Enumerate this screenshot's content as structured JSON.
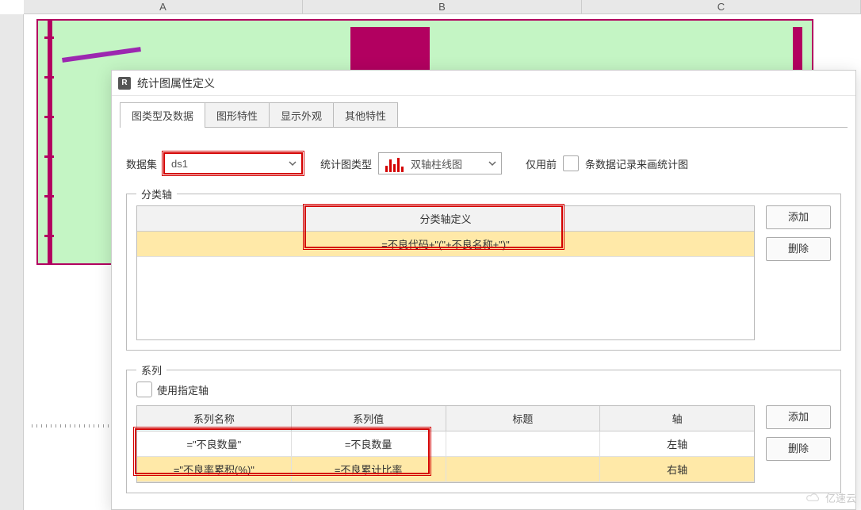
{
  "bg": {
    "cols": [
      "A",
      "B",
      "C"
    ]
  },
  "dialog": {
    "title": "统计图属性定义",
    "tabs": [
      "图类型及数据",
      "图形特性",
      "显示外观",
      "其他特性"
    ],
    "row1": {
      "dataset_label": "数据集",
      "dataset_value": "ds1",
      "charttype_label": "统计图类型",
      "charttype_value": "双轴柱线图",
      "only_prefix": "仅用前",
      "only_suffix": "条数据记录来画统计图"
    },
    "category": {
      "legend": "分类轴",
      "header": "分类轴定义",
      "row0": "=不良代码+\"(\"+不良名称+\")\"",
      "add": "添加",
      "del": "删除"
    },
    "series": {
      "legend": "系列",
      "use_axis": "使用指定轴",
      "headers": [
        "系列名称",
        "系列值",
        "标题",
        "轴"
      ],
      "rows": [
        {
          "name": "=\"不良数量\"",
          "value": "=不良数量",
          "title": "",
          "axis": "左轴"
        },
        {
          "name": "=\"不良率累积(%)\"",
          "value": "=不良累计比率",
          "title": "",
          "axis": "右轴"
        }
      ],
      "add": "添加",
      "del": "删除"
    }
  },
  "watermark": "亿速云"
}
